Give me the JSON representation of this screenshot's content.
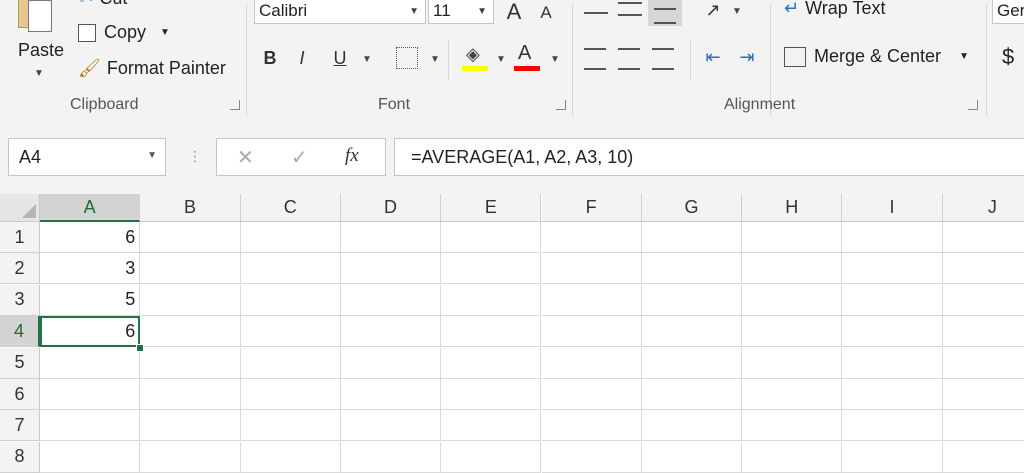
{
  "ribbon": {
    "clipboard": {
      "cut": "Cut",
      "copy": "Copy",
      "paste": "Paste",
      "format_painter": "Format Painter",
      "label": "Clipboard"
    },
    "font": {
      "name": "Calibri",
      "size": "11",
      "bold": "B",
      "italic": "I",
      "underline": "U",
      "font_color_glyph": "A",
      "label": "Font"
    },
    "alignment": {
      "wrap_text": "Wrap Text",
      "merge_center": "Merge & Center",
      "label": "Alignment"
    },
    "number": {
      "format": "Ger",
      "currency": "$"
    }
  },
  "formula_bar": {
    "name_box": "A4",
    "formula": "=AVERAGE(A1, A2, A3, 10)",
    "fx": "fx"
  },
  "sheet": {
    "columns": [
      "A",
      "B",
      "C",
      "D",
      "E",
      "F",
      "G",
      "H",
      "I",
      "J"
    ],
    "rows": [
      "1",
      "2",
      "3",
      "4",
      "5",
      "6",
      "7",
      "8"
    ],
    "values": {
      "A1": "6",
      "A2": "3",
      "A3": "5",
      "A4": "6"
    },
    "active_cell": "A4"
  },
  "colors": {
    "accent": "#217346",
    "fill_yellow": "#ffff00",
    "font_red": "#ff0000"
  }
}
